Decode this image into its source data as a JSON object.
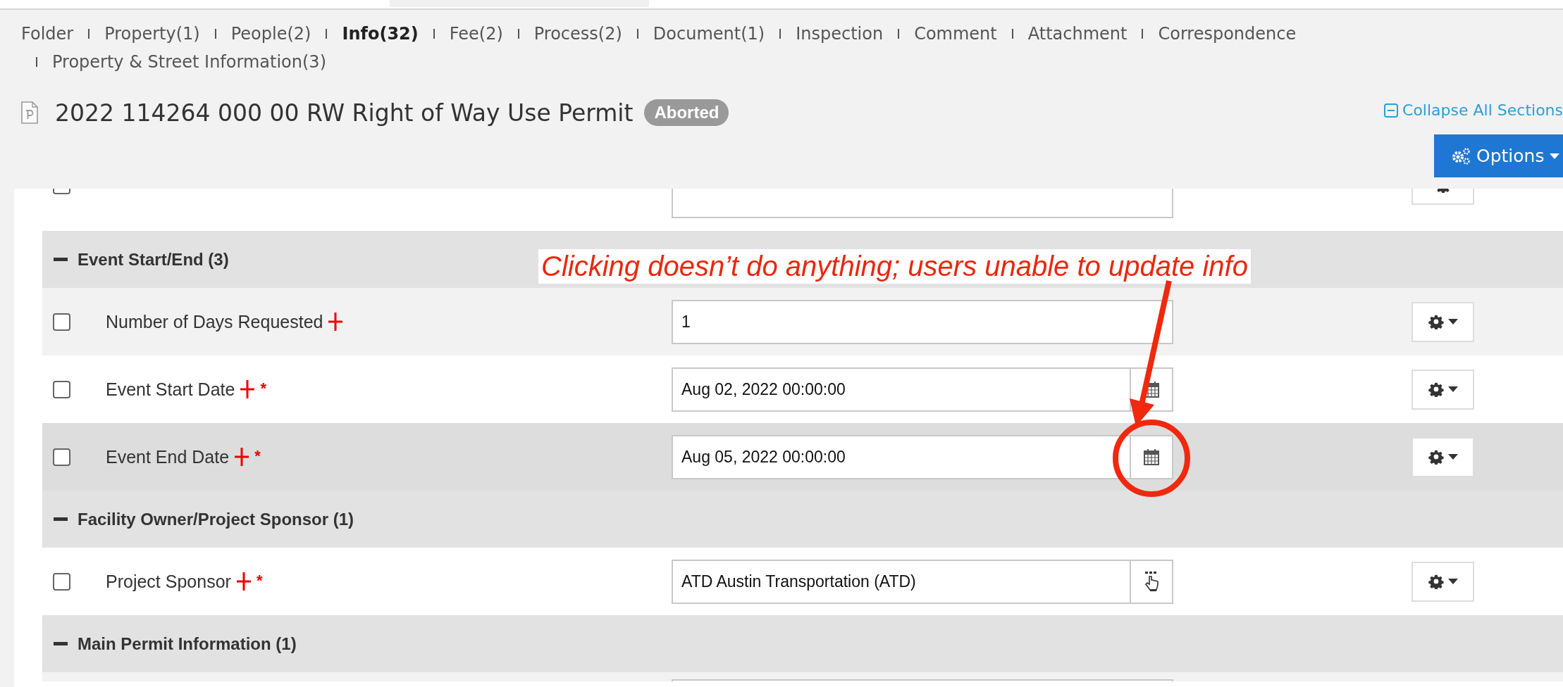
{
  "tabs": [
    {
      "label": "Folder",
      "selected": false
    },
    {
      "label": "Property(1)",
      "selected": false
    },
    {
      "label": "People(2)",
      "selected": false
    },
    {
      "label": "Info(32)",
      "selected": true
    },
    {
      "label": "Fee(2)",
      "selected": false
    },
    {
      "label": "Process(2)",
      "selected": false
    },
    {
      "label": "Document(1)",
      "selected": false
    },
    {
      "label": "Inspection",
      "selected": false
    },
    {
      "label": "Comment",
      "selected": false
    },
    {
      "label": "Attachment",
      "selected": false
    },
    {
      "label": "Correspondence",
      "selected": false
    },
    {
      "label": "Property & Street Information(3)",
      "selected": false
    }
  ],
  "record": {
    "title": "2022 114264 000 00 RW Right of Way Use Permit",
    "status": "Aborted"
  },
  "collapse_link": "Collapse All Sections",
  "options_button": "Options",
  "cut_row": {
    "checked": false
  },
  "items": [
    {
      "kind": "section",
      "title": "Event Start/End (3)",
      "expanded": true
    },
    {
      "kind": "field",
      "label": "Number of Days Requested",
      "required": true,
      "asterisk": false,
      "value": "1",
      "calendar": false,
      "picker": false,
      "checked": false,
      "hovered": false
    },
    {
      "kind": "field",
      "label": "Event Start Date",
      "required": true,
      "asterisk": true,
      "value": "Aug 02, 2022 00:00:00",
      "calendar": true,
      "picker": false,
      "checked": false,
      "hovered": false
    },
    {
      "kind": "field",
      "label": "Event End Date",
      "required": true,
      "asterisk": true,
      "value": "Aug 05, 2022 00:00:00",
      "calendar": true,
      "picker": false,
      "checked": false,
      "hovered": true
    },
    {
      "kind": "section",
      "title": "Facility Owner/Project Sponsor (1)",
      "expanded": true
    },
    {
      "kind": "field",
      "label": "Project Sponsor",
      "required": true,
      "asterisk": true,
      "value": "ATD Austin Transportation (ATD)",
      "calendar": false,
      "picker": true,
      "checked": false,
      "hovered": false
    },
    {
      "kind": "section",
      "title": "Main Permit Information (1)",
      "expanded": true
    }
  ],
  "annotation": {
    "note": "Clicking doesn’t do anything; users unable to update info",
    "asterisk": "*"
  }
}
